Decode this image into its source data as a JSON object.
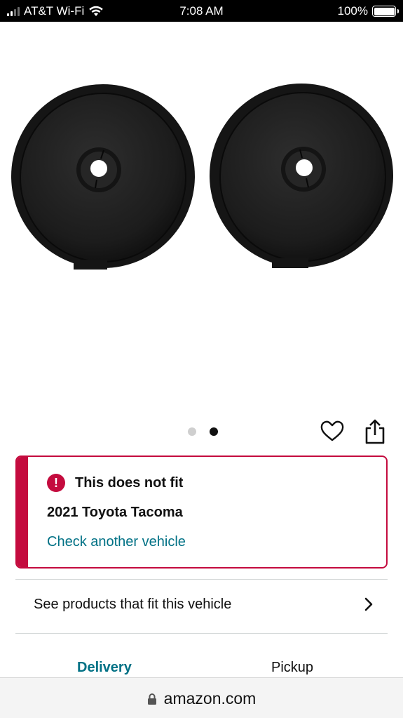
{
  "status_bar": {
    "carrier": "AT&T Wi-Fi",
    "time": "7:08 AM",
    "battery": "100%"
  },
  "product": {
    "image_alt": "",
    "image_count": 2,
    "active_image_index": 1
  },
  "fitment": {
    "alert_title": "This does not fit",
    "vehicle": "2021 Toyota Tacoma",
    "check_link": "Check another vehicle",
    "accent_color": "#c40b3e"
  },
  "see_products": {
    "label": "See products that fit this vehicle"
  },
  "fulfillment_tabs": {
    "delivery": "Delivery",
    "pickup": "Pickup",
    "active": "Delivery"
  },
  "browser": {
    "url": "amazon.com"
  },
  "colors": {
    "link": "#007185",
    "alert": "#c40b3e"
  }
}
